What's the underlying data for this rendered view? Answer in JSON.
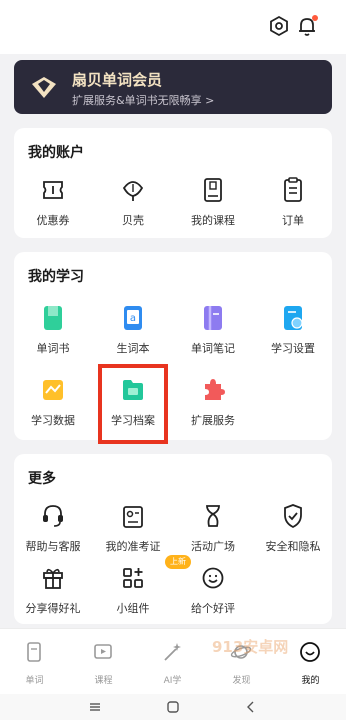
{
  "vip": {
    "title": "扇贝单词会员",
    "subtitle": "扩展服务&单词书无限畅享 >"
  },
  "account": {
    "title": "我的账户",
    "items": [
      {
        "label": "优惠券",
        "icon": "coupon-icon"
      },
      {
        "label": "贝壳",
        "icon": "shell-icon"
      },
      {
        "label": "我的课程",
        "icon": "course-icon"
      },
      {
        "label": "订单",
        "icon": "order-icon"
      }
    ]
  },
  "study": {
    "title": "我的学习",
    "items": [
      {
        "label": "单词书",
        "icon": "word-book-icon"
      },
      {
        "label": "生词本",
        "icon": "new-words-icon"
      },
      {
        "label": "单词笔记",
        "icon": "word-notes-icon"
      },
      {
        "label": "学习设置",
        "icon": "study-settings-icon"
      },
      {
        "label": "学习数据",
        "icon": "study-data-icon"
      },
      {
        "label": "学习档案",
        "icon": "study-archive-icon"
      },
      {
        "label": "扩展服务",
        "icon": "extension-icon"
      }
    ]
  },
  "more": {
    "title": "更多",
    "new_tag": "上新",
    "items": [
      {
        "label": "帮助与客服",
        "icon": "headset-icon"
      },
      {
        "label": "我的准考证",
        "icon": "admission-ticket-icon"
      },
      {
        "label": "活动广场",
        "icon": "activity-icon"
      },
      {
        "label": "安全和隐私",
        "icon": "shield-icon"
      },
      {
        "label": "分享得好礼",
        "icon": "gift-icon"
      },
      {
        "label": "小组件",
        "icon": "widget-icon"
      },
      {
        "label": "给个好评",
        "icon": "smile-icon"
      }
    ]
  },
  "tabs": [
    {
      "label": "单词",
      "icon": "word-tab-icon"
    },
    {
      "label": "课程",
      "icon": "course-tab-icon"
    },
    {
      "label": "AI学",
      "icon": "ai-tab-icon"
    },
    {
      "label": "发现",
      "icon": "planet-icon"
    },
    {
      "label": "我的",
      "icon": "me-tab-icon"
    }
  ],
  "watermark": "913安卓网",
  "colors": {
    "highlight": "#e8341f",
    "vip_bg": "#2b2a3a",
    "vip_text": "#f3e2c2",
    "new_tag": "#ffb21a"
  }
}
